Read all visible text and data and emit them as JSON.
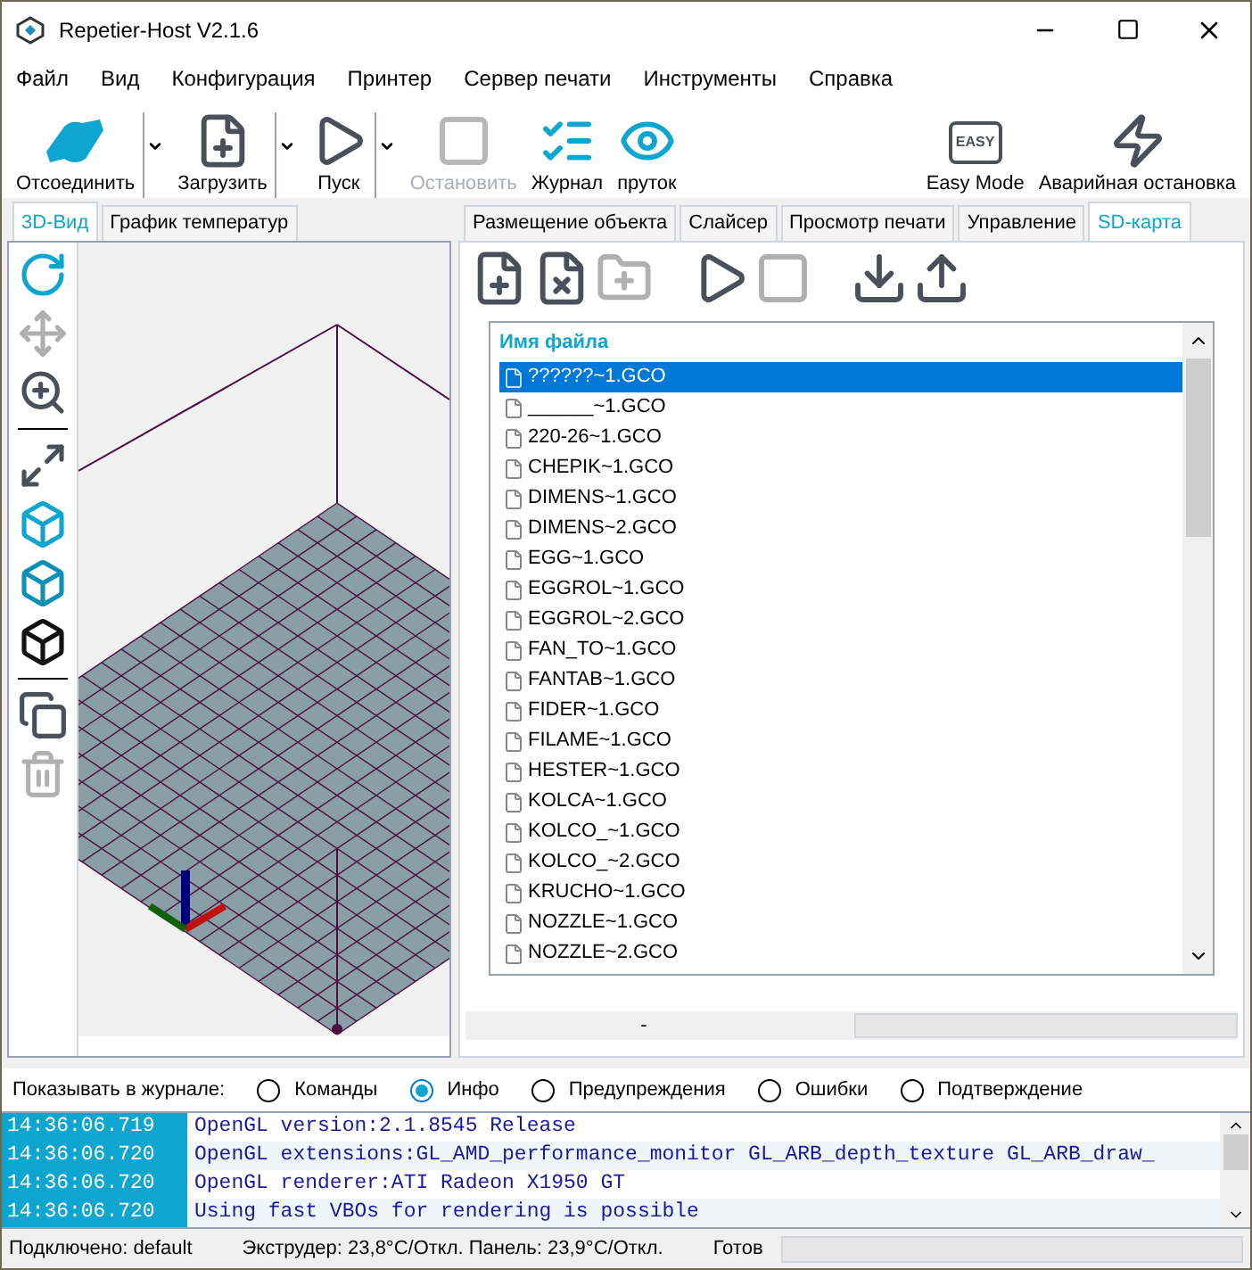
{
  "window": {
    "title": "Repetier-Host V2.1.6"
  },
  "menu": [
    "Файл",
    "Вид",
    "Конфигурация",
    "Принтер",
    "Сервер печати",
    "Инструменты",
    "Справка"
  ],
  "toolbar": [
    {
      "kind": "connect",
      "label": "Отсоединить",
      "disabled": false,
      "dropdown": true
    },
    {
      "kind": "load",
      "label": "Загрузить",
      "disabled": false,
      "dropdown": true
    },
    {
      "kind": "start",
      "label": "Пуск",
      "disabled": false,
      "dropdown": true
    },
    {
      "kind": "stop",
      "label": "Остановить",
      "disabled": true,
      "dropdown": false
    },
    {
      "kind": "log",
      "label": "Журнал",
      "disabled": false,
      "dropdown": false
    },
    {
      "kind": "filament",
      "label": "пруток",
      "disabled": false,
      "dropdown": false
    },
    {
      "kind": "easy",
      "label": "Easy Mode",
      "badge": "EASY",
      "disabled": false,
      "dropdown": false
    },
    {
      "kind": "emergency",
      "label": "Аварийная остановка",
      "disabled": false,
      "dropdown": false
    }
  ],
  "left_tabs": [
    {
      "label": "3D-Вид",
      "selected": true
    },
    {
      "label": "График температур",
      "selected": false
    }
  ],
  "view_tools": [
    {
      "kind": "rotate",
      "disabled": false
    },
    {
      "kind": "move",
      "disabled": true
    },
    {
      "kind": "zoom",
      "disabled": false
    },
    {
      "kind": "separator"
    },
    {
      "kind": "fit",
      "disabled": false
    },
    {
      "kind": "cube-top",
      "disabled": false
    },
    {
      "kind": "cube-side",
      "disabled": false
    },
    {
      "kind": "cube-iso",
      "disabled": false
    },
    {
      "kind": "separator"
    },
    {
      "kind": "copy",
      "disabled": false
    },
    {
      "kind": "delete",
      "disabled": true
    }
  ],
  "right_tabs": [
    {
      "label": "Размещение объекта",
      "selected": false
    },
    {
      "label": "Слайсер",
      "selected": false
    },
    {
      "label": "Просмотр печати",
      "selected": false
    },
    {
      "label": "Управление",
      "selected": false
    },
    {
      "label": "SD-карта",
      "selected": true
    }
  ],
  "sd_tools": [
    {
      "kind": "add-file",
      "disabled": false
    },
    {
      "kind": "delete-file",
      "disabled": false
    },
    {
      "kind": "new-folder",
      "disabled": true
    },
    {
      "kind": "start",
      "disabled": false
    },
    {
      "kind": "stop",
      "disabled": true
    },
    {
      "kind": "download",
      "disabled": false
    },
    {
      "kind": "upload",
      "disabled": false
    }
  ],
  "file_list": {
    "column": "Имя файла",
    "rows": [
      {
        "name": "??????~1.GCO",
        "selected": true
      },
      {
        "name": "______~1.GCO",
        "selected": false
      },
      {
        "name": "220-26~1.GCO",
        "selected": false
      },
      {
        "name": "CHEPIK~1.GCO",
        "selected": false
      },
      {
        "name": "DIMENS~1.GCO",
        "selected": false
      },
      {
        "name": "DIMENS~2.GCO",
        "selected": false
      },
      {
        "name": "EGG~1.GCO",
        "selected": false
      },
      {
        "name": "EGGROL~1.GCO",
        "selected": false
      },
      {
        "name": "EGGROL~2.GCO",
        "selected": false
      },
      {
        "name": "FAN_TO~1.GCO",
        "selected": false
      },
      {
        "name": "FANTAB~1.GCO",
        "selected": false
      },
      {
        "name": "FIDER~1.GCO",
        "selected": false
      },
      {
        "name": "FILAME~1.GCO",
        "selected": false
      },
      {
        "name": "HESTER~1.GCO",
        "selected": false
      },
      {
        "name": "KOLCA~1.GCO",
        "selected": false
      },
      {
        "name": "KOLCO_~1.GCO",
        "selected": false
      },
      {
        "name": "KOLCO_~2.GCO",
        "selected": false
      },
      {
        "name": "KRUCHO~1.GCO",
        "selected": false
      },
      {
        "name": "NOZZLE~1.GCO",
        "selected": false
      },
      {
        "name": "NOZZLE~2.GCO",
        "selected": false
      }
    ]
  },
  "sd_status": {
    "label": "-",
    "level": 0
  },
  "log_filter": {
    "label": "Показывать в журнале:",
    "options": [
      {
        "label": "Команды",
        "selected": false
      },
      {
        "label": "Инфо",
        "selected": true
      },
      {
        "label": "Предупреждения",
        "selected": false
      },
      {
        "label": "Ошибки",
        "selected": false
      },
      {
        "label": "Подтверждение",
        "selected": false
      }
    ]
  },
  "log": [
    {
      "time": "14:36:06.719",
      "message": "OpenGL version:2.1.8545 Release"
    },
    {
      "time": "14:36:06.720",
      "message": "OpenGL extensions:GL_AMD_performance_monitor GL_ARB_depth_texture GL_ARB_draw_"
    },
    {
      "time": "14:36:06.720",
      "message": "OpenGL renderer:ATI Radeon X1950 GT"
    },
    {
      "time": "14:36:06.720",
      "message": "Using fast VBOs for rendering is possible"
    }
  ],
  "status_bar": {
    "connection": "Подключено: default",
    "temperatures": "Экструдер: 23,8°C/Откл. Панель: 23,9°C/Откл.",
    "state": "Готов",
    "level": 0
  }
}
